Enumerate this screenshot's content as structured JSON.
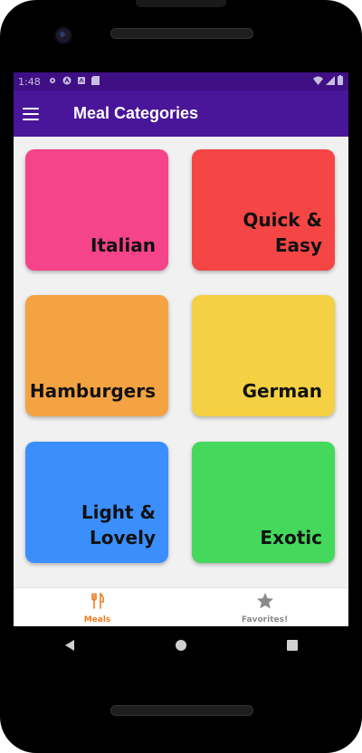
{
  "status_bar": {
    "time": "1:48"
  },
  "app_bar": {
    "title": "Meal Categories"
  },
  "categories": [
    {
      "label": "Italian",
      "color": "#f5448a"
    },
    {
      "label": "Quick & Easy",
      "color": "#f64545"
    },
    {
      "label": "Hamburgers",
      "color": "#f4a343"
    },
    {
      "label": "German",
      "color": "#f5d043"
    },
    {
      "label": "Light &\nLovely",
      "color": "#3b8ffd"
    },
    {
      "label": "Exotic",
      "color": "#44d85c"
    }
  ],
  "bottom_nav": {
    "items": [
      {
        "label": "Meals",
        "icon": "restaurant-icon",
        "active": true
      },
      {
        "label": "Favorites!",
        "icon": "star-icon",
        "active": false
      }
    ]
  },
  "colors": {
    "accent": "#ef7d22",
    "app_bar": "#4a1699",
    "status_bar": "#3f0f84"
  }
}
